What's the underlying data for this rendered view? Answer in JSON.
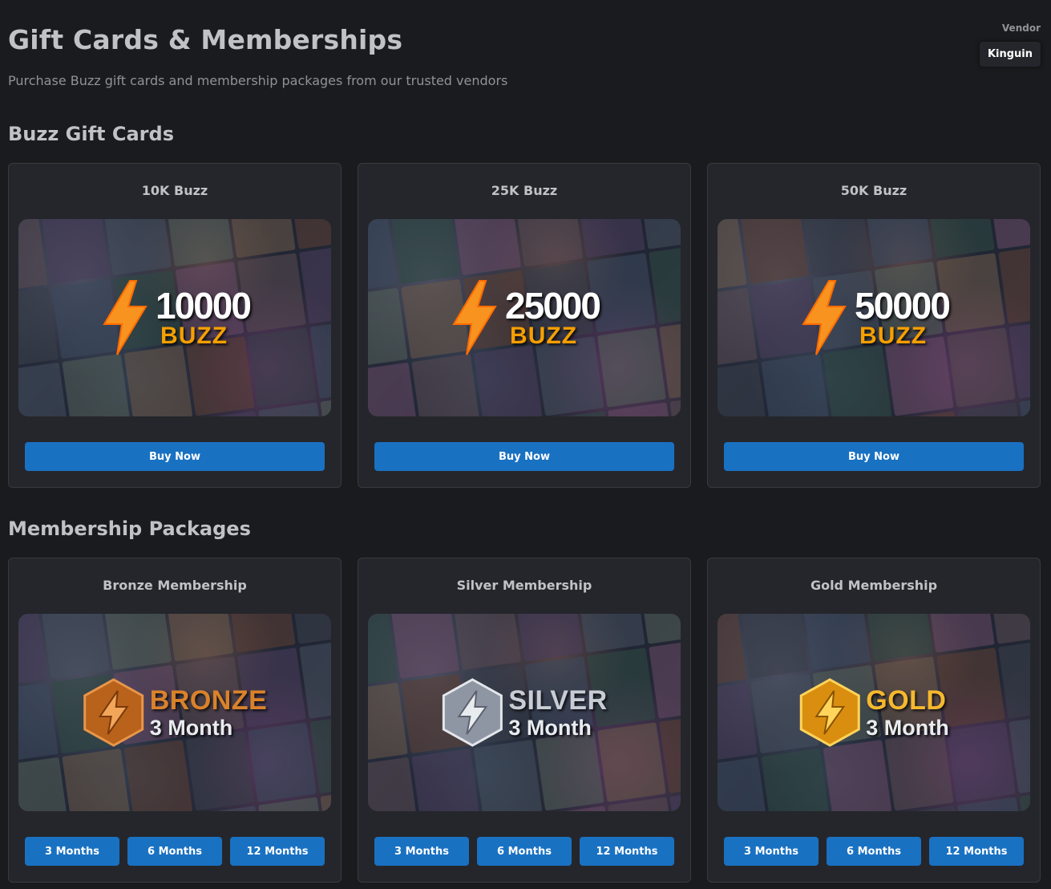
{
  "header": {
    "title": "Gift Cards & Memberships",
    "subtitle": "Purchase Buzz gift cards and membership packages from our trusted vendors"
  },
  "vendor": {
    "label": "Vendor",
    "selected": "Kinguin"
  },
  "gift_cards": {
    "section_title": "Buzz Gift Cards",
    "cards": [
      {
        "title": "10K Buzz",
        "amount": "10000",
        "unit": "BUZZ",
        "button": "Buy Now"
      },
      {
        "title": "25K Buzz",
        "amount": "25000",
        "unit": "BUZZ",
        "button": "Buy Now"
      },
      {
        "title": "50K Buzz",
        "amount": "50000",
        "unit": "BUZZ",
        "button": "Buy Now"
      }
    ]
  },
  "memberships": {
    "section_title": "Membership Packages",
    "cards": [
      {
        "title": "Bronze Membership",
        "tier": "BRONZE",
        "duration_label": "3 Month",
        "color": "#d9822b",
        "buttons": [
          "3 Months",
          "6 Months",
          "12 Months"
        ]
      },
      {
        "title": "Silver Membership",
        "tier": "SILVER",
        "duration_label": "3 Month",
        "color": "#c8ccd4",
        "buttons": [
          "3 Months",
          "6 Months",
          "12 Months"
        ]
      },
      {
        "title": "Gold Membership",
        "tier": "GOLD",
        "duration_label": "3 Month",
        "color": "#f5b82e",
        "buttons": [
          "3 Months",
          "6 Months",
          "12 Months"
        ]
      }
    ]
  },
  "colors": {
    "accent": "#1971c2",
    "background": "#1a1b1e",
    "card": "#25262b",
    "buzz": "#f59f00"
  }
}
